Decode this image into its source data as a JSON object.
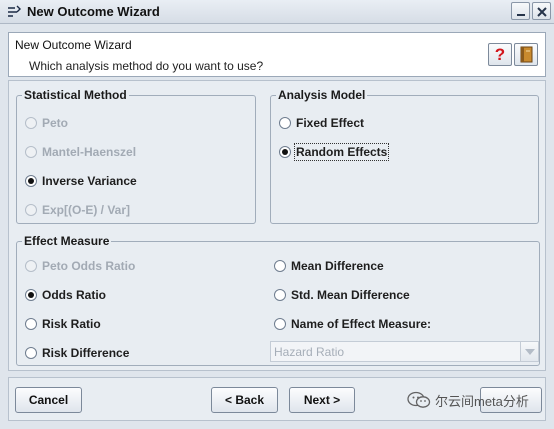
{
  "window": {
    "title": "New Outcome Wizard",
    "icon": "wizard-app-icon"
  },
  "header": {
    "title": "New Outcome Wizard",
    "subtitle": "Which analysis method do you want to use?",
    "help_glyph": "?",
    "help_icon": "help-icon",
    "book_icon": "book-icon"
  },
  "statistical_method": {
    "legend": "Statistical Method",
    "options": [
      {
        "label": "Peto",
        "checked": false,
        "enabled": false
      },
      {
        "label": "Mantel-Haenszel",
        "checked": false,
        "enabled": false
      },
      {
        "label": "Inverse Variance",
        "checked": true,
        "enabled": true
      },
      {
        "label": "Exp[(O-E) / Var]",
        "checked": false,
        "enabled": false
      }
    ]
  },
  "analysis_model": {
    "legend": "Analysis Model",
    "options": [
      {
        "label": "Fixed Effect",
        "checked": false,
        "enabled": true
      },
      {
        "label": "Random Effects",
        "checked": true,
        "enabled": true
      }
    ]
  },
  "effect_measure": {
    "legend": "Effect Measure",
    "left_options": [
      {
        "label": "Peto Odds Ratio",
        "checked": false,
        "enabled": false
      },
      {
        "label": "Odds Ratio",
        "checked": true,
        "enabled": true
      },
      {
        "label": "Risk Ratio",
        "checked": false,
        "enabled": true
      },
      {
        "label": "Risk Difference",
        "checked": false,
        "enabled": true
      }
    ],
    "right_options": [
      {
        "label": "Mean Difference",
        "checked": false,
        "enabled": true
      },
      {
        "label": "Std. Mean Difference",
        "checked": false,
        "enabled": true
      },
      {
        "label": "Name of Effect Measure:",
        "checked": false,
        "enabled": true
      }
    ],
    "effect_name_value": "Hazard Ratio"
  },
  "footer": {
    "cancel_label": "Cancel",
    "back_label": "< Back",
    "next_label": "Next >",
    "watermark_text": "尔云间meta分析"
  },
  "colors": {
    "background": "#dfe5ec",
    "panel": "#e8edf2",
    "disabled_text": "#a2aab4",
    "help_red": "#d2151b"
  }
}
